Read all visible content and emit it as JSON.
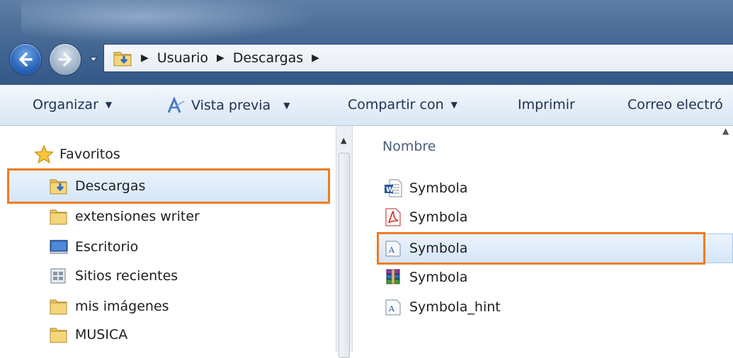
{
  "address_bar": {
    "crumbs": [
      "Usuario",
      "Descargas"
    ]
  },
  "toolbar": {
    "organize": "Organizar",
    "preview": "Vista previa",
    "share": "Compartir con",
    "print": "Imprimir",
    "email": "Correo electró"
  },
  "navigation": {
    "favorites_label": "Favoritos",
    "items": [
      {
        "label": "Descargas",
        "icon": "download-folder-icon"
      },
      {
        "label": "extensiones writer",
        "icon": "folder-icon"
      },
      {
        "label": "Escritorio",
        "icon": "desktop-icon"
      },
      {
        "label": "Sitios recientes",
        "icon": "recent-places-icon"
      },
      {
        "label": "mis imágenes",
        "icon": "folder-icon"
      },
      {
        "label": "MUSICA",
        "icon": "folder-icon"
      }
    ]
  },
  "file_list": {
    "column_header": "Nombre",
    "files": [
      {
        "name": "Symbola",
        "icon": "word-document-icon"
      },
      {
        "name": "Symbola",
        "icon": "pdf-icon"
      },
      {
        "name": "Symbola",
        "icon": "font-file-icon"
      },
      {
        "name": "Symbola",
        "icon": "rar-archive-icon"
      },
      {
        "name": "Symbola_hint",
        "icon": "font-file-icon"
      }
    ]
  },
  "colors": {
    "highlight": "#f07b22",
    "selection": "#d5e6f8",
    "titlebar": "#4b6d97"
  }
}
